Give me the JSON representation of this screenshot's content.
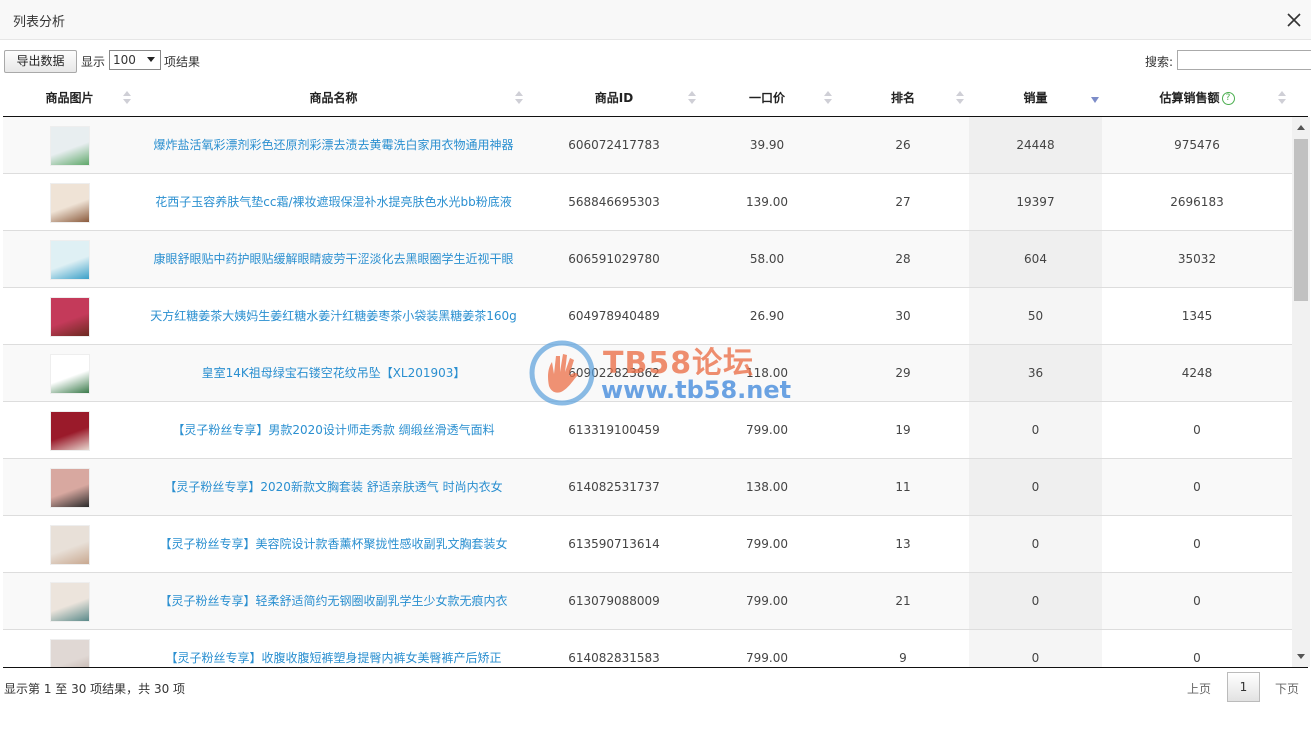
{
  "dialog": {
    "title": "列表分析"
  },
  "toolbar": {
    "export_label": "导出数据",
    "show_label": "显示",
    "page_length": "100",
    "results_label": "项结果",
    "search_label": "搜索:",
    "search_value": ""
  },
  "columns": [
    {
      "label": "商品图片",
      "sort": "none"
    },
    {
      "label": "商品名称",
      "sort": "none"
    },
    {
      "label": "商品ID",
      "sort": "none"
    },
    {
      "label": "一口价",
      "sort": "none"
    },
    {
      "label": "排名",
      "sort": "none"
    },
    {
      "label": "销量",
      "sort": "desc"
    },
    {
      "label": "估算销售额",
      "sort": "none",
      "help_icon": "question-circle-icon"
    }
  ],
  "rows": [
    {
      "name": "爆炸盐活氧彩漂剂彩色还原剂彩漂去渍去黄霉洗白家用衣物通用神器",
      "id": "606072417783",
      "price": "39.90",
      "rank": "26",
      "sales": "24448",
      "revenue": "975476",
      "thumb_color": "#e8eef0",
      "thumb_accent": "#5fa86a"
    },
    {
      "name": "花西子玉容养肤气垫cc霜/裸妆遮瑕保湿补水提亮肤色水光bb粉底液",
      "id": "568846695303",
      "price": "139.00",
      "rank": "27",
      "sales": "19397",
      "revenue": "2696183",
      "thumb_color": "#efe3d6",
      "thumb_accent": "#8a5a3c"
    },
    {
      "name": "康眼舒眼贴中药护眼贴缓解眼睛疲劳干涩淡化去黑眼圈学生近视干眼",
      "id": "606591029780",
      "price": "58.00",
      "rank": "28",
      "sales": "604",
      "revenue": "35032",
      "thumb_color": "#dff0f4",
      "thumb_accent": "#3aa0c8"
    },
    {
      "name": "天方红糖姜茶大姨妈生姜红糖水姜汁红糖姜枣茶小袋装黑糖姜茶160g",
      "id": "604978940489",
      "price": "26.90",
      "rank": "30",
      "sales": "50",
      "revenue": "1345",
      "thumb_color": "#c43a5a",
      "thumb_accent": "#6b2a20"
    },
    {
      "name": "皇室14K祖母绿宝石镂空花纹吊坠【XL201903】",
      "id": "609022823862",
      "price": "118.00",
      "rank": "29",
      "sales": "36",
      "revenue": "4248",
      "thumb_color": "#ffffff",
      "thumb_accent": "#3a7a4a"
    },
    {
      "name": "【灵子粉丝专享】男款2020设计师走秀款 绸缎丝滑透气面料",
      "id": "613319100459",
      "price": "799.00",
      "rank": "19",
      "sales": "0",
      "revenue": "0",
      "thumb_color": "#9a1a2a",
      "thumb_accent": "#e8d8d0"
    },
    {
      "name": "【灵子粉丝专享】2020新款文胸套装 舒适亲肤透气 时尚内衣女",
      "id": "614082531737",
      "price": "138.00",
      "rank": "11",
      "sales": "0",
      "revenue": "0",
      "thumb_color": "#d8a8a0",
      "thumb_accent": "#2a2a2a"
    },
    {
      "name": "【灵子粉丝专享】美容院设计款香薰杯聚拢性感收副乳文胸套装女",
      "id": "613590713614",
      "price": "799.00",
      "rank": "13",
      "sales": "0",
      "revenue": "0",
      "thumb_color": "#e8e0d8",
      "thumb_accent": "#c8a890"
    },
    {
      "name": "【灵子粉丝专享】轻柔舒适简约无钢圈收副乳学生少女款无痕内衣",
      "id": "613079088009",
      "price": "799.00",
      "rank": "21",
      "sales": "0",
      "revenue": "0",
      "thumb_color": "#ece4dc",
      "thumb_accent": "#5a8a8a"
    },
    {
      "name": "【灵子粉丝专享】收腹收腹短裤塑身提臀内裤女美臀裤产后矫正",
      "id": "614082831583",
      "price": "799.00",
      "rank": "9",
      "sales": "0",
      "revenue": "0",
      "thumb_color": "#e0d8d4",
      "thumb_accent": "#b8a8a0"
    }
  ],
  "footer": {
    "info": "显示第 1 至 30 项结果，共 30 项",
    "prev_label": "上页",
    "current_page": "1",
    "next_label": "下页"
  },
  "watermark": {
    "title": "TB58论坛",
    "url": "www.tb58.net"
  },
  "colors": {
    "link": "#2a8fd0",
    "sort_active": "#7c8cc8",
    "help": "#4caf50"
  }
}
